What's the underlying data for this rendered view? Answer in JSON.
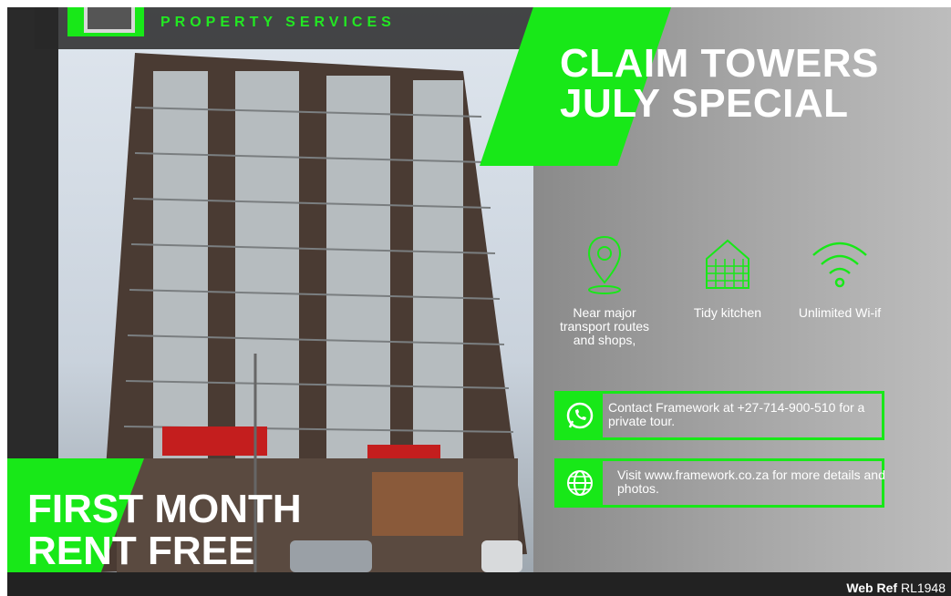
{
  "brand": {
    "tagline": "PROPERTY SERVICES"
  },
  "title": {
    "line1": "CLAIM TOWERS",
    "line2": "JULY SPECIAL"
  },
  "features": [
    {
      "icon": "location-pin-icon",
      "label": "Near major transport routes and shops,"
    },
    {
      "icon": "house-icon",
      "label": "Tidy kitchen"
    },
    {
      "icon": "wifi-icon",
      "label": "Unlimited Wi-if"
    }
  ],
  "contacts": [
    {
      "icon": "whatsapp-icon",
      "text": "Contact Framework at +27-714-900-510 for a private tour."
    },
    {
      "icon": "globe-icon",
      "text": "Visit www.framework.co.za for more details and photos."
    }
  ],
  "promo": {
    "line1": "FIRST MONTH",
    "line2": "RENT FREE"
  },
  "footer": {
    "webref_label": "Web Ref",
    "webref_value": "RL1948"
  },
  "colors": {
    "accent": "#18e818",
    "text": "#ffffff",
    "panel": "#a5a5a5"
  }
}
